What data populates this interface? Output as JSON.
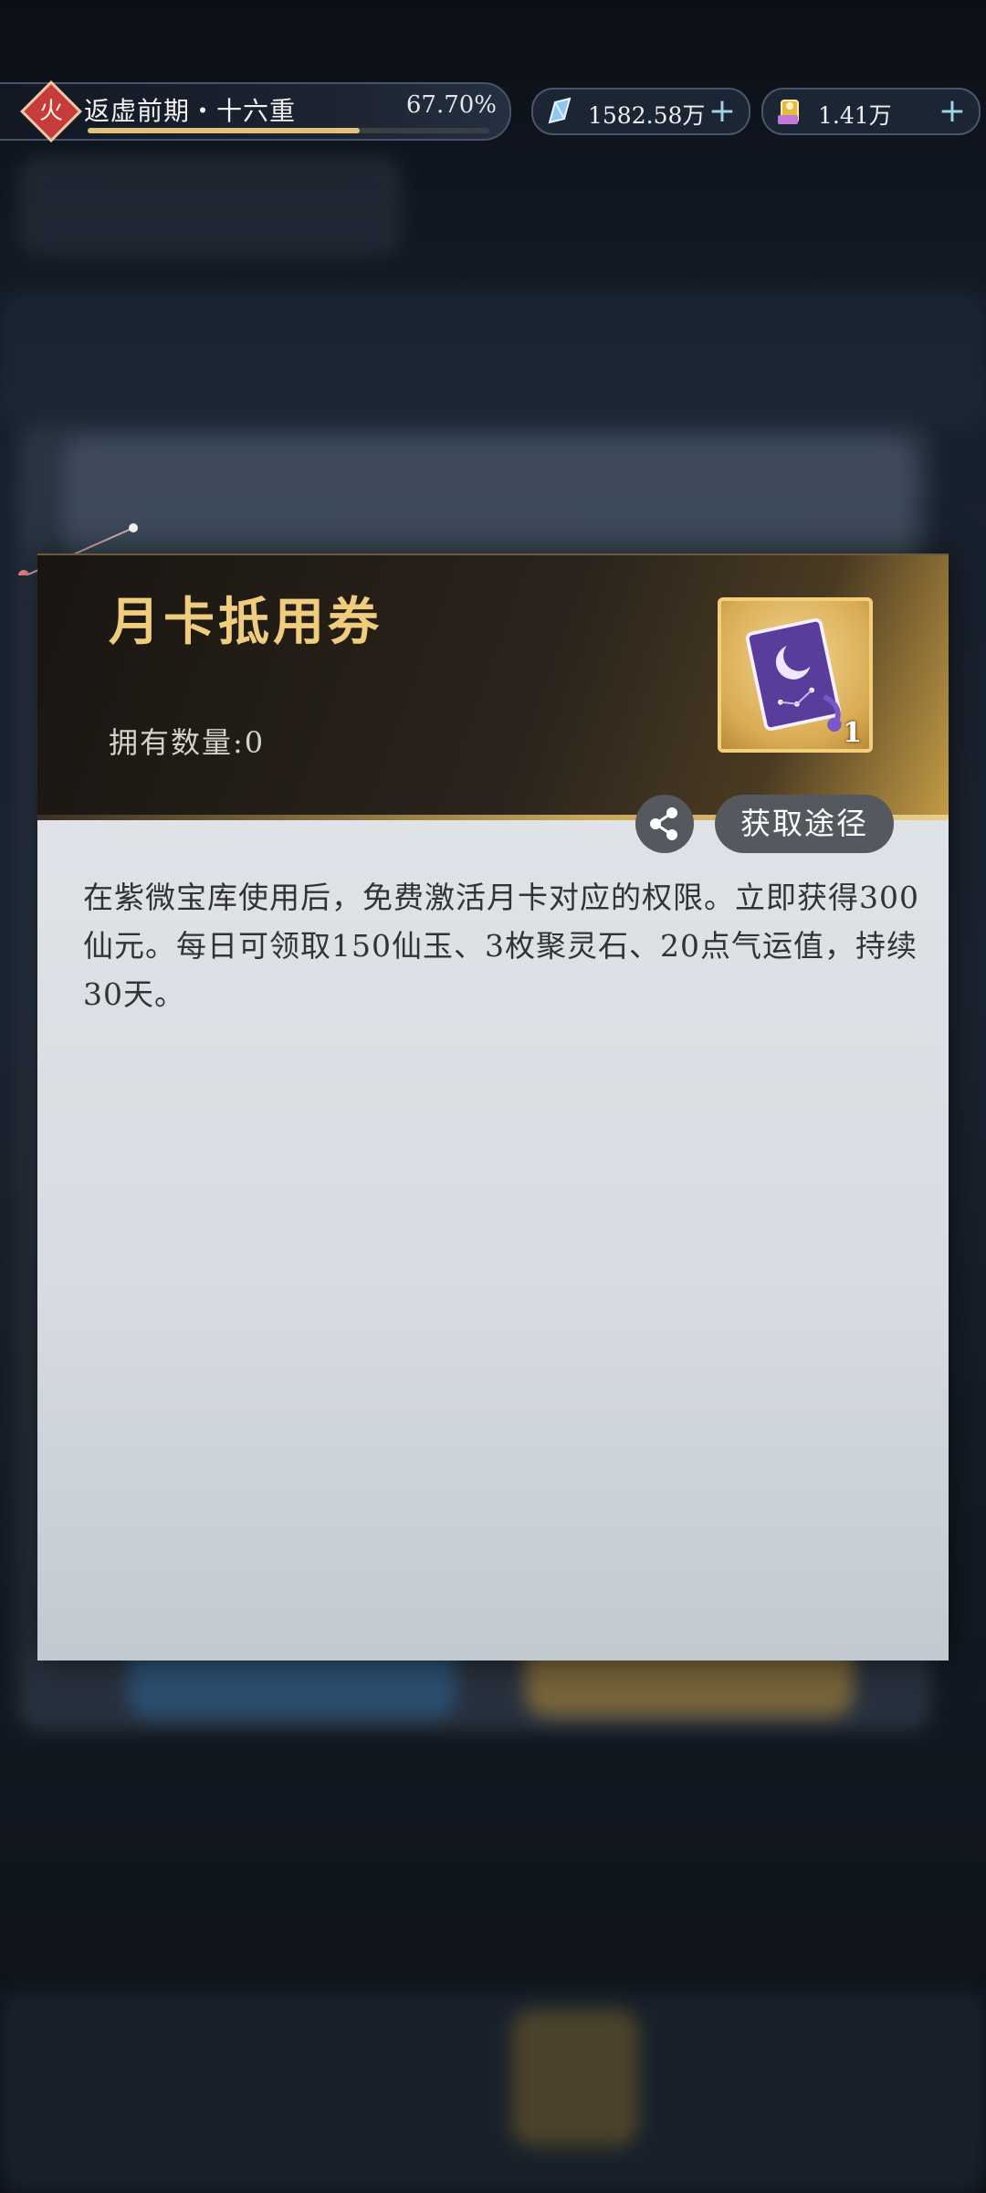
{
  "status_bar": {
    "element_badge": "火",
    "realm_name": "返虚前期・十六重",
    "realm_progress_text": "67.70%",
    "realm_progress": 0.677,
    "jade_amount": "1582.58万",
    "gold_amount": "1.41万"
  },
  "item_popup": {
    "title": "月卡抵用券",
    "owned_label": "拥有数量:0",
    "item_count": "1",
    "obtain_route_label": "获取途径",
    "description": "在紫微宝库使用后，免费激活月卡对应的权限。立即获得300仙元。每日可领取150仙玉、3枚聚灵石、20点气运值，持续30天。"
  },
  "colors": {
    "title_gold": "#f0cd7c",
    "fire_red": "#c63c3c",
    "progress_gold": "#e2c27a",
    "panel_body": "#dfe3e8"
  },
  "icons": [
    "fire-element-icon",
    "jade-crystal-icon",
    "gold-scroll-icon",
    "plus-icon",
    "share-icon",
    "monthly-card-item-icon"
  ]
}
